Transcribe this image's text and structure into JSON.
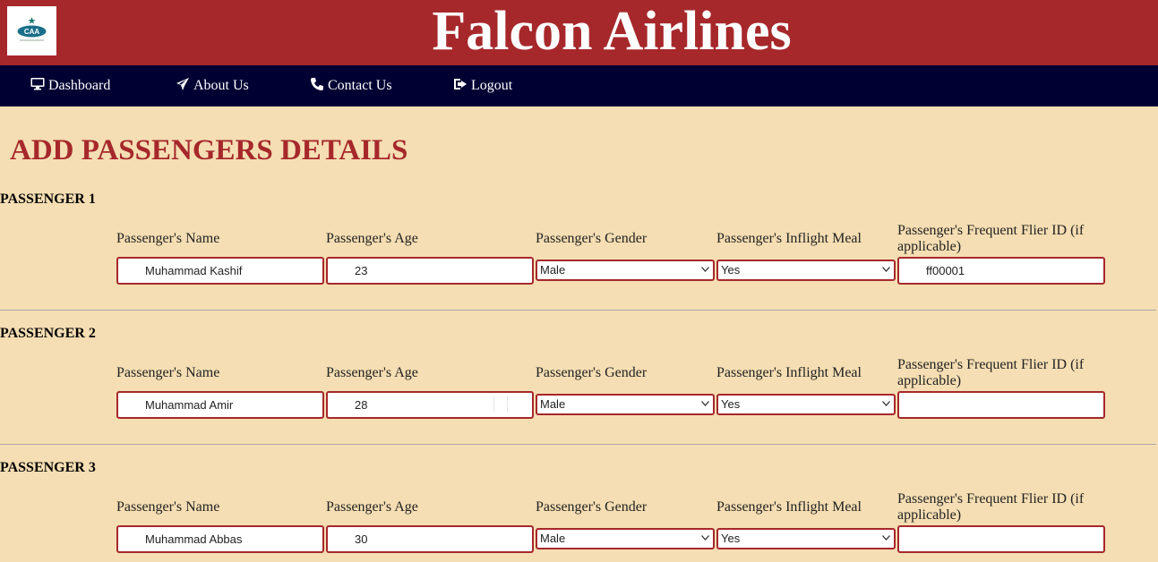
{
  "header": {
    "title": "Falcon Airlines",
    "logo_text": "CAA"
  },
  "nav": [
    {
      "label": "Dashboard",
      "icon": "monitor-icon"
    },
    {
      "label": "About Us",
      "icon": "plane-icon"
    },
    {
      "label": "Contact Us",
      "icon": "phone-icon"
    },
    {
      "label": "Logout",
      "icon": "logout-icon"
    }
  ],
  "page_title": "ADD PASSENGERS DETAILS",
  "labels": {
    "name": "Passenger's Name",
    "age": "Passenger's Age",
    "gender": "Passenger's Gender",
    "meal": "Passenger's Inflight Meal",
    "ffid": "Passenger's Frequent Flier ID (if applicable)"
  },
  "passengers": [
    {
      "heading": "PASSENGER 1",
      "name": "Muhammad Kashif",
      "age": "23",
      "gender": "Male",
      "meal": "Yes",
      "ffid": "ff00001"
    },
    {
      "heading": "PASSENGER 2",
      "name": "Muhammad Amir",
      "age": "28",
      "gender": "Male",
      "meal": "Yes",
      "ffid": ""
    },
    {
      "heading": "PASSENGER 3",
      "name": "Muhammad Abbas",
      "age": "30",
      "gender": "Male",
      "meal": "Yes",
      "ffid": ""
    }
  ],
  "colors": {
    "brand": "#a6282b",
    "nav": "#000033",
    "background": "#f5deb3"
  }
}
